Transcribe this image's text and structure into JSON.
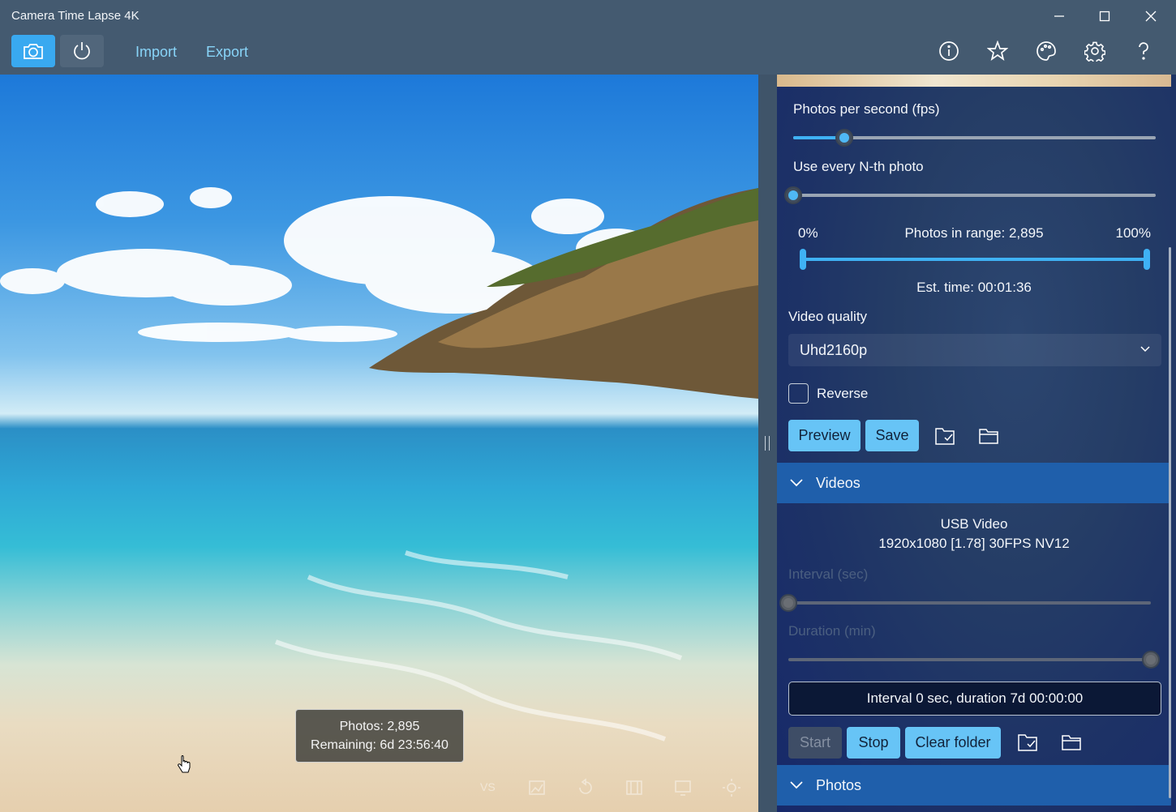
{
  "window": {
    "title": "Camera Time Lapse 4K",
    "minimize_icon": "minimize-icon",
    "maximize_icon": "maximize-icon",
    "close_icon": "close-icon"
  },
  "toolbar": {
    "camera_icon": "camera-icon",
    "power_icon": "power-icon",
    "import_label": "Import",
    "export_label": "Export",
    "right_icons": [
      "info-icon",
      "star-icon",
      "palette-icon",
      "gear-icon",
      "help-icon"
    ]
  },
  "preview": {
    "photos_line": "Photos: 2,895",
    "remaining_line": "Remaining: 6d 23:56:40",
    "bottom_icons": [
      "vs-icon",
      "image-edit-icon",
      "rotate-icon",
      "crop-icon",
      "monitor-icon",
      "brightness-icon"
    ]
  },
  "panel": {
    "fps_label": "Photos per second (fps)",
    "fps_level": 0.14,
    "nth_label": "Use every N-th photo",
    "nth_level": 0.0,
    "range_start": "0%",
    "range_center": "Photos in range: 2,895",
    "range_end": "100%",
    "est_time": "Est. time: 00:01:36",
    "video_quality_label": "Video quality",
    "video_quality_value": "Uhd2160p",
    "reverse_label": "Reverse",
    "preview_button": "Preview",
    "save_button": "Save",
    "videos_header": "Videos",
    "camera_name": "USB Video",
    "camera_mode": "1920x1080 [1.78] 30FPS NV12",
    "interval_label": "Interval (sec)",
    "interval_level": 0.0,
    "duration_label": "Duration (min)",
    "duration_level": 1.0,
    "status_text": "Interval 0 sec, duration 7d 00:00:00",
    "start_button": "Start",
    "stop_button": "Stop",
    "clear_button": "Clear folder",
    "photos_header": "Photos"
  },
  "colors": {
    "accent": "#39a9f0",
    "button": "#67c4f6",
    "section_header": "#1f5fab"
  }
}
